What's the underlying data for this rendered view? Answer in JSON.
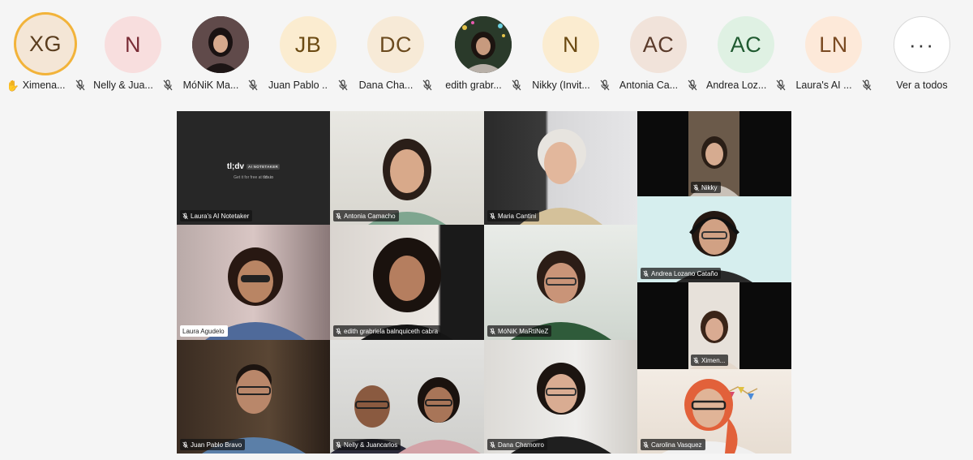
{
  "participants_strip": [
    {
      "initials": "XG",
      "name": "Ximena...",
      "avatar_bg": "#f4e6d6",
      "text_color": "#5a3d1e",
      "speaking": true,
      "hand_raised": true,
      "muted": true
    },
    {
      "initials": "N",
      "name": "Nelly & Jua...",
      "avatar_bg": "#f8dede",
      "text_color": "#7a2c36",
      "muted": true
    },
    {
      "initials": "",
      "name": "MóNiK Ma...",
      "photo": true,
      "muted": true
    },
    {
      "initials": "JB",
      "name": "Juan Pablo ...",
      "avatar_bg": "#fbecd0",
      "text_color": "#6b4a12",
      "muted": true
    },
    {
      "initials": "DC",
      "name": "Dana Cha...",
      "avatar_bg": "#f7ead7",
      "text_color": "#6b4a1e",
      "muted": true
    },
    {
      "initials": "",
      "name": "edith grabr...",
      "photo": true,
      "muted": true
    },
    {
      "initials": "N",
      "name": "Nikky (Invit...",
      "avatar_bg": "#fbecd0",
      "text_color": "#6b4a12",
      "muted": true
    },
    {
      "initials": "AC",
      "name": "Antonia Ca...",
      "avatar_bg": "#f1e3da",
      "text_color": "#5a3a2a",
      "muted": true
    },
    {
      "initials": "AC",
      "name": "Andrea Loz...",
      "avatar_bg": "#dff1e3",
      "text_color": "#1f5a30",
      "muted": true
    },
    {
      "initials": "LN",
      "name": "Laura's AI ...",
      "avatar_bg": "#fde9d9",
      "text_color": "#7a4a22",
      "muted": true
    }
  ],
  "more": {
    "label": "Ver a todos",
    "icon": "more-dots-icon",
    "glyph": "···"
  },
  "tldv": {
    "logo": "tl;dv",
    "badge": "AI NOTETAKER",
    "sub_prefix": "Get it for free at",
    "sub_link": "tldv.io"
  },
  "tiles": {
    "t0": {
      "label": "Laura's AI Notetaker",
      "muted": true
    },
    "t1": {
      "label": "Antonia Camacho",
      "muted": true
    },
    "t2": {
      "label": "Maria Cantini",
      "muted": true
    },
    "t3": {
      "label": "Nikky",
      "muted": true
    },
    "t4": {
      "label": "Laura Agudelo",
      "muted": false
    },
    "t5": {
      "label": "edith  grabriela balnquiceth  cabra",
      "muted": true
    },
    "t6": {
      "label": "MóNiK MaRtiNeZ",
      "muted": true
    },
    "t7": {
      "label": "Andrea Lozano Cataño",
      "muted": true
    },
    "t8": {
      "label": "Ximen...",
      "muted": true
    },
    "t9": {
      "label": "Juan Pablo Bravo",
      "muted": true
    },
    "t10": {
      "label": "Nelly & Juancarlos",
      "muted": true
    },
    "t11": {
      "label": "Dana Chamorro",
      "muted": true
    },
    "t12": {
      "label": "Carolina Vasquez",
      "muted": true
    }
  }
}
